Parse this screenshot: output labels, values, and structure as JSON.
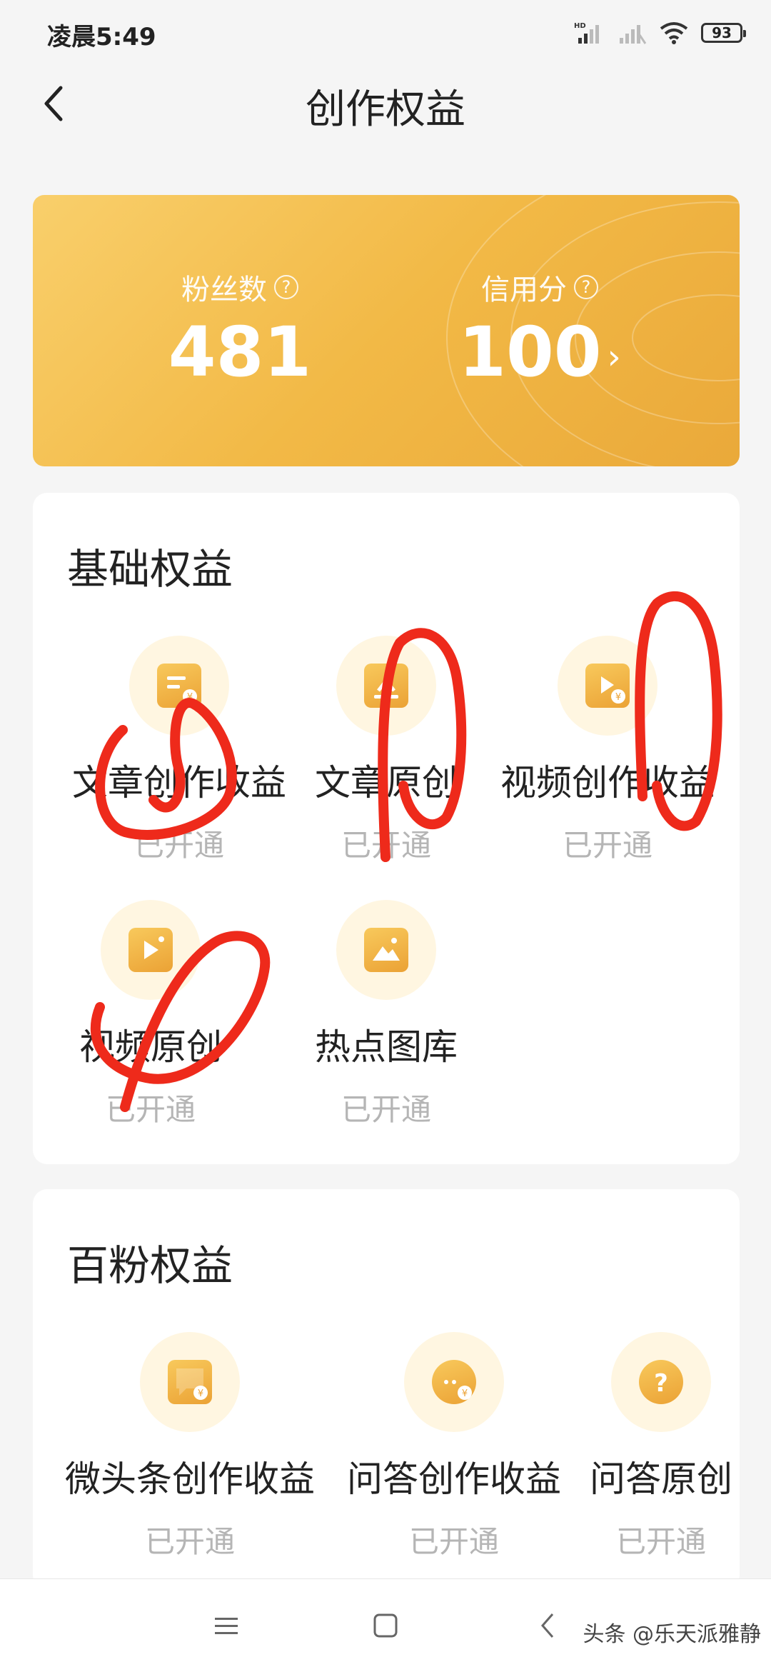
{
  "status_bar": {
    "time": "凌晨5:49",
    "battery": "93",
    "network_label": "HD"
  },
  "header": {
    "title": "创作权益"
  },
  "stats": {
    "fans_label": "粉丝数",
    "fans_value": "481",
    "credit_label": "信用分",
    "credit_value": "100"
  },
  "basic_section": {
    "title": "基础权益",
    "items": [
      {
        "name": "文章创作收益",
        "status": "已开通",
        "icon": "article-income-icon"
      },
      {
        "name": "文章原创",
        "status": "已开通",
        "icon": "article-original-icon"
      },
      {
        "name": "视频创作收益",
        "status": "已开通",
        "icon": "video-income-icon"
      },
      {
        "name": "视频原创",
        "status": "已开通",
        "icon": "video-original-icon"
      },
      {
        "name": "热点图库",
        "status": "已开通",
        "icon": "image-library-icon"
      }
    ]
  },
  "fans100_section": {
    "title": "百粉权益",
    "items": [
      {
        "name": "微头条创作收益",
        "status": "已开通",
        "icon": "micro-post-income-icon"
      },
      {
        "name": "问答创作收益",
        "status": "已开通",
        "icon": "qa-income-icon"
      },
      {
        "name": "问答原创",
        "status": "已开通",
        "icon": "qa-original-icon"
      }
    ]
  },
  "system_nav": {
    "watermark": "头条 @乐天派雅静"
  },
  "colors": {
    "accent": "#f2b946",
    "scribble": "#ee2a1b",
    "muted": "#b5b5b5"
  }
}
